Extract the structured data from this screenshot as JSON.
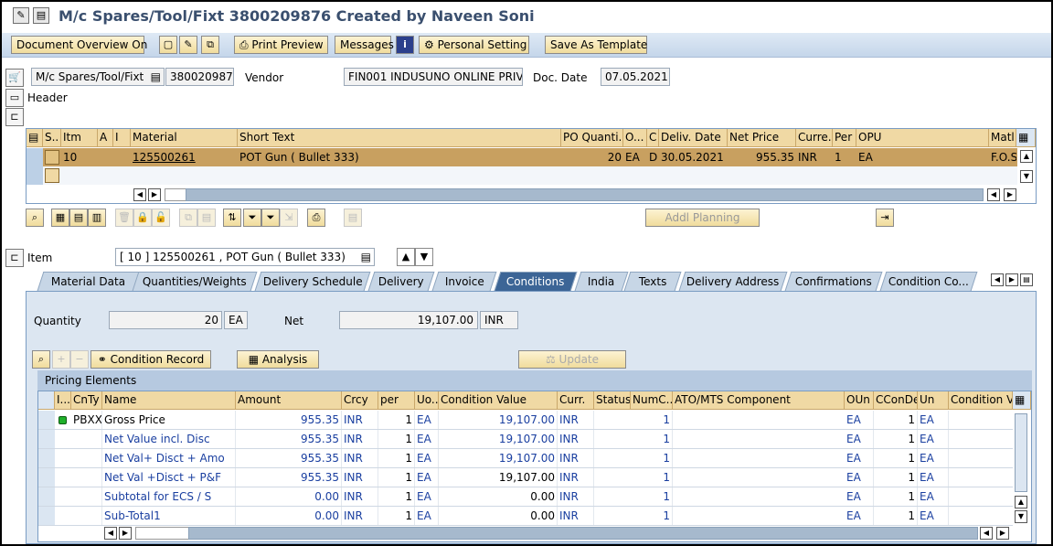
{
  "window": {
    "title": "M/c Spares/Tool/Fixt 3800209876 Created by Naveen Soni"
  },
  "appbar": {
    "doc_overview": "Document Overview On",
    "print_preview": "Print Preview",
    "messages": "Messages",
    "personal_setting": "Personal Setting",
    "save_template": "Save As Template"
  },
  "header": {
    "doc_type": "M/c Spares/Tool/Fixt",
    "doc_number": "3800209876",
    "vendor_label": "Vendor",
    "vendor": "FIN001 INDUSUNO ONLINE PRIV...",
    "date_label": "Doc. Date",
    "date": "07.05.2021",
    "section": "Header"
  },
  "items_table": {
    "columns": [
      "S..",
      "Itm",
      "A",
      "I",
      "Material",
      "Short Text",
      "PO Quanti...",
      "O...",
      "C",
      "Deliv. Date",
      "Net Price",
      "Curre...",
      "Per",
      "OPU",
      "Matl G"
    ],
    "rows": [
      {
        "itm": "10",
        "material": "125500261",
        "short_text": "POT Gun ( Bullet 333)",
        "qty": "20",
        "unit": "EA",
        "c": "D",
        "deliv_date": "30.05.2021",
        "net_price": "955.35",
        "curr": "INR",
        "per": "1",
        "opu": "EA",
        "matl_group": "F.O.S"
      }
    ]
  },
  "planning": {
    "label": "Addl Planning"
  },
  "item_selector": {
    "label": "Item",
    "value": "[ 10 ] 125500261 , POT Gun ( Bullet 333)"
  },
  "tabs": [
    "Material Data",
    "Quantities/Weights",
    "Delivery Schedule",
    "Delivery",
    "Invoice",
    "Conditions",
    "India",
    "Texts",
    "Delivery Address",
    "Confirmations",
    "Condition Co..."
  ],
  "active_tab": "Conditions",
  "conditions": {
    "quantity_label": "Quantity",
    "quantity": "20",
    "quantity_unit": "EA",
    "net_label": "Net",
    "net": "19,107.00",
    "net_curr": "INR",
    "condition_record": "Condition Record",
    "analysis": "Analysis",
    "update": "Update",
    "pricing_title": "Pricing Elements"
  },
  "pricing_table": {
    "columns": [
      "I...",
      "CnTy",
      "Name",
      "Amount",
      "Crcy",
      "per",
      "Uo...",
      "Condition Value",
      "Curr.",
      "Status",
      "NumC...",
      "ATO/MTS Component",
      "OUn",
      "CConDe",
      "Un",
      "Condition Va"
    ],
    "rows": [
      {
        "cnty": "PBXX",
        "name": "Gross Price",
        "amount": "955.35",
        "crcy": "INR",
        "per": "1",
        "uom": "EA",
        "value": "19,107.00",
        "curr": "INR",
        "numc": "1",
        "oun": "EA",
        "ccon": "1",
        "un": "EA"
      },
      {
        "cnty": "",
        "name": "Net Value incl. Disc",
        "amount": "955.35",
        "crcy": "INR",
        "per": "1",
        "uom": "EA",
        "value": "19,107.00",
        "curr": "INR",
        "numc": "1",
        "oun": "EA",
        "ccon": "1",
        "un": "EA"
      },
      {
        "cnty": "",
        "name": "Net Val+ Disct + Amo",
        "amount": "955.35",
        "crcy": "INR",
        "per": "1",
        "uom": "EA",
        "value": "19,107.00",
        "curr": "INR",
        "numc": "1",
        "oun": "EA",
        "ccon": "1",
        "un": "EA"
      },
      {
        "cnty": "",
        "name": "Net Val +Disct + P&F",
        "amount": "955.35",
        "crcy": "INR",
        "per": "1",
        "uom": "EA",
        "value": "19,107.00",
        "curr": "INR",
        "numc": "1",
        "oun": "EA",
        "ccon": "1",
        "un": "EA"
      },
      {
        "cnty": "",
        "name": "Subtotal for ECS / S",
        "amount": "0.00",
        "crcy": "INR",
        "per": "1",
        "uom": "EA",
        "value": "0.00",
        "curr": "INR",
        "numc": "1",
        "oun": "EA",
        "ccon": "1",
        "un": "EA"
      },
      {
        "cnty": "",
        "name": "Sub-Total1",
        "amount": "0.00",
        "crcy": "INR",
        "per": "1",
        "uom": "EA",
        "value": "0.00",
        "curr": "INR",
        "numc": "1",
        "oun": "EA",
        "ccon": "1",
        "un": "EA"
      }
    ]
  },
  "colors": {
    "header_bg": "#f0d9a4",
    "selected_row": "#c8a060",
    "link_blue": "#1a3fa0",
    "active_tab": "#3c6596"
  }
}
